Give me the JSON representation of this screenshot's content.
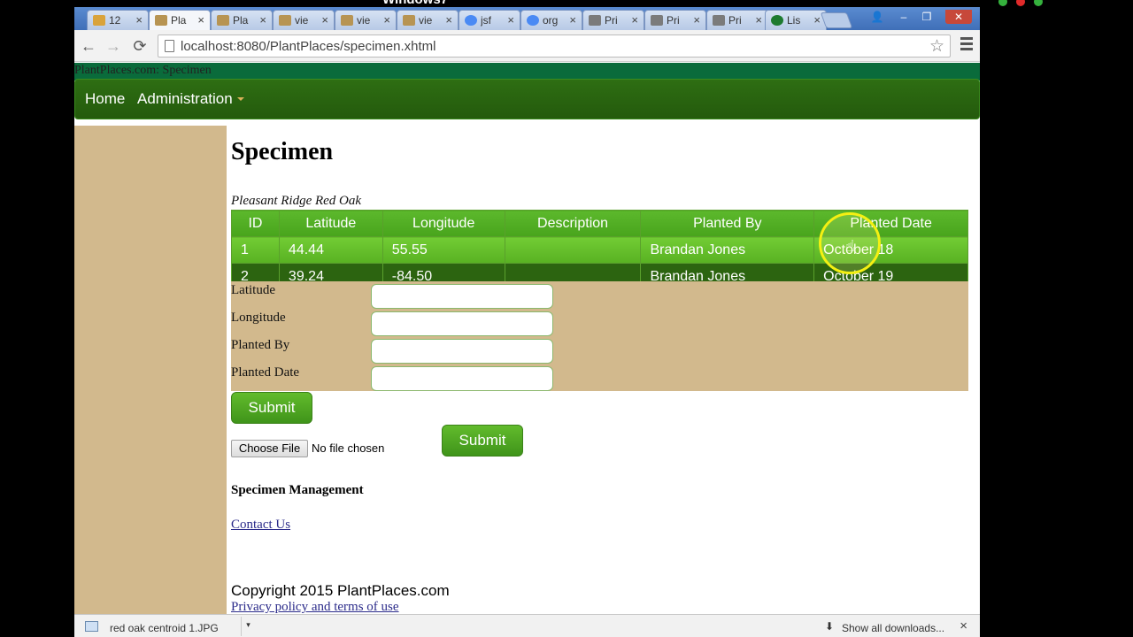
{
  "os": {
    "title_fragment": "Windows7",
    "tray_colors": [
      "#35b13d",
      "#e02a2a",
      "#35b13d"
    ]
  },
  "browser": {
    "tabs": [
      {
        "label": "12",
        "icon": "pma-icon",
        "color": "#d9a33b"
      },
      {
        "label": "Pla",
        "icon": "plantplaces-icon",
        "color": "#b79453"
      },
      {
        "label": "Pla",
        "icon": "plantplaces-icon",
        "color": "#b79453"
      },
      {
        "label": "vie",
        "icon": "plantplaces-icon",
        "color": "#b79453"
      },
      {
        "label": "vie",
        "icon": "plantplaces-icon",
        "color": "#b79453"
      },
      {
        "label": "vie",
        "icon": "plantplaces-icon",
        "color": "#b79453"
      },
      {
        "label": "jsf",
        "icon": "google-icon",
        "color": "#4a8af4"
      },
      {
        "label": "org",
        "icon": "google-icon",
        "color": "#4a8af4"
      },
      {
        "label": "Pri",
        "icon": "shield-icon",
        "color": "#7b7b7b"
      },
      {
        "label": "Pri",
        "icon": "shield-icon",
        "color": "#7b7b7b"
      },
      {
        "label": "Pri",
        "icon": "shield-icon",
        "color": "#7b7b7b"
      },
      {
        "label": "Lis",
        "icon": "p-icon",
        "color": "#1d7a2f"
      }
    ],
    "active_tab": 1,
    "close_glyph": "×",
    "window_buttons": [
      "👤",
      "–",
      "❐",
      "✕"
    ],
    "back_glyph": "←",
    "forward_glyph": "→",
    "reload_glyph": "⟳",
    "url": "localhost:8080/PlantPlaces/specimen.xhtml",
    "star_glyph": "☆"
  },
  "page": {
    "document_title": "PlantPlaces.com: Specimen",
    "nav": {
      "home": "Home",
      "administration": "Administration"
    },
    "heading": "Specimen",
    "caption": "Pleasant Ridge Red Oak",
    "table": {
      "headers": [
        "ID",
        "Latitude",
        "Longitude",
        "Description",
        "Planted By",
        "Planted Date"
      ],
      "rows": [
        [
          "1",
          "44.44",
          "55.55",
          "",
          "Brandan Jones",
          "October 18"
        ],
        [
          "2",
          "39.24",
          "-84.50",
          "",
          "Brandan Jones",
          "October 19"
        ]
      ]
    },
    "form": {
      "latitude_label": "Latitude",
      "longitude_label": "Longitude",
      "planted_by_label": "Planted By",
      "planted_date_label": "Planted Date",
      "latitude_value": "",
      "longitude_value": "",
      "planted_by_value": "",
      "planted_date_value": "",
      "submit_label": "Submit"
    },
    "upload": {
      "choose_label": "Choose File",
      "status": "No file chosen",
      "submit_label": "Submit"
    },
    "management": "Specimen Management",
    "contact": "Contact Us",
    "copyright": "Copyright 2015 PlantPlaces.com",
    "privacy": "Privacy policy and terms of use"
  },
  "downloads": {
    "file_name": "red oak centroid 1.JPG",
    "arrow_glyph": "▾",
    "show_all": "Show all downloads...",
    "show_all_glyph": "⬇",
    "close_glyph": "×"
  },
  "theme": {
    "nav_green": "#2e6e13",
    "header_green": "#5cb82c",
    "row_light": "#66c02b",
    "row_dark": "#2c6410",
    "tan": "#d2b98d"
  }
}
